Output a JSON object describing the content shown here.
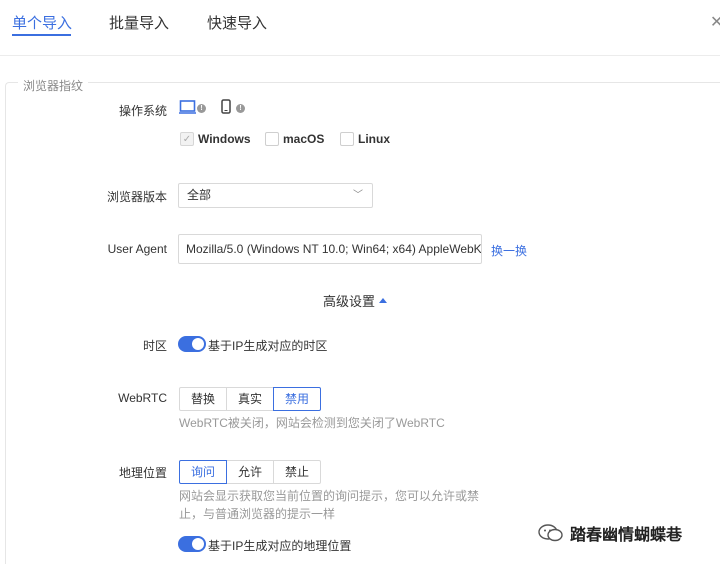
{
  "tabs": [
    {
      "label": "单个导入",
      "active": true
    },
    {
      "label": "批量导入",
      "active": false
    },
    {
      "label": "快速导入",
      "active": false
    }
  ],
  "section": {
    "legend": "浏览器指纹"
  },
  "os": {
    "label": "操作系统",
    "icons": [
      "laptop-icon",
      "phone-icon"
    ],
    "options": [
      {
        "label": "Windows",
        "checked": true
      },
      {
        "label": "macOS",
        "checked": false
      },
      {
        "label": "Linux",
        "checked": false
      }
    ]
  },
  "browser_version": {
    "label": "浏览器版本",
    "value": "全部"
  },
  "user_agent": {
    "label": "User Agent",
    "value": "Mozilla/5.0 (Windows NT 10.0; Win64; x64) AppleWebK",
    "action": "换一换"
  },
  "advanced": {
    "label": "高级设置"
  },
  "timezone": {
    "label": "时区",
    "toggle_text": "基于IP生成对应的时区",
    "on": true
  },
  "webrtc": {
    "label": "WebRTC",
    "options": [
      "替换",
      "真实",
      "禁用"
    ],
    "selected": "禁用",
    "hint": "WebRTC被关闭，网站会检测到您关闭了WebRTC"
  },
  "geolocation": {
    "label": "地理位置",
    "options": [
      "询问",
      "允许",
      "禁止"
    ],
    "selected": "询问",
    "hint_line1": "网站会显示获取您当前位置的询问提示，您可以允许或禁",
    "hint_line2": "止，与普通浏览器的提示一样",
    "toggle_text": "基于IP生成对应的地理位置",
    "on": true
  },
  "watermark": {
    "text": "踏春幽情蝴蝶巷"
  },
  "colors": {
    "accent": "#3b6fe0",
    "border": "#d9d9d9",
    "hint": "#999999"
  }
}
